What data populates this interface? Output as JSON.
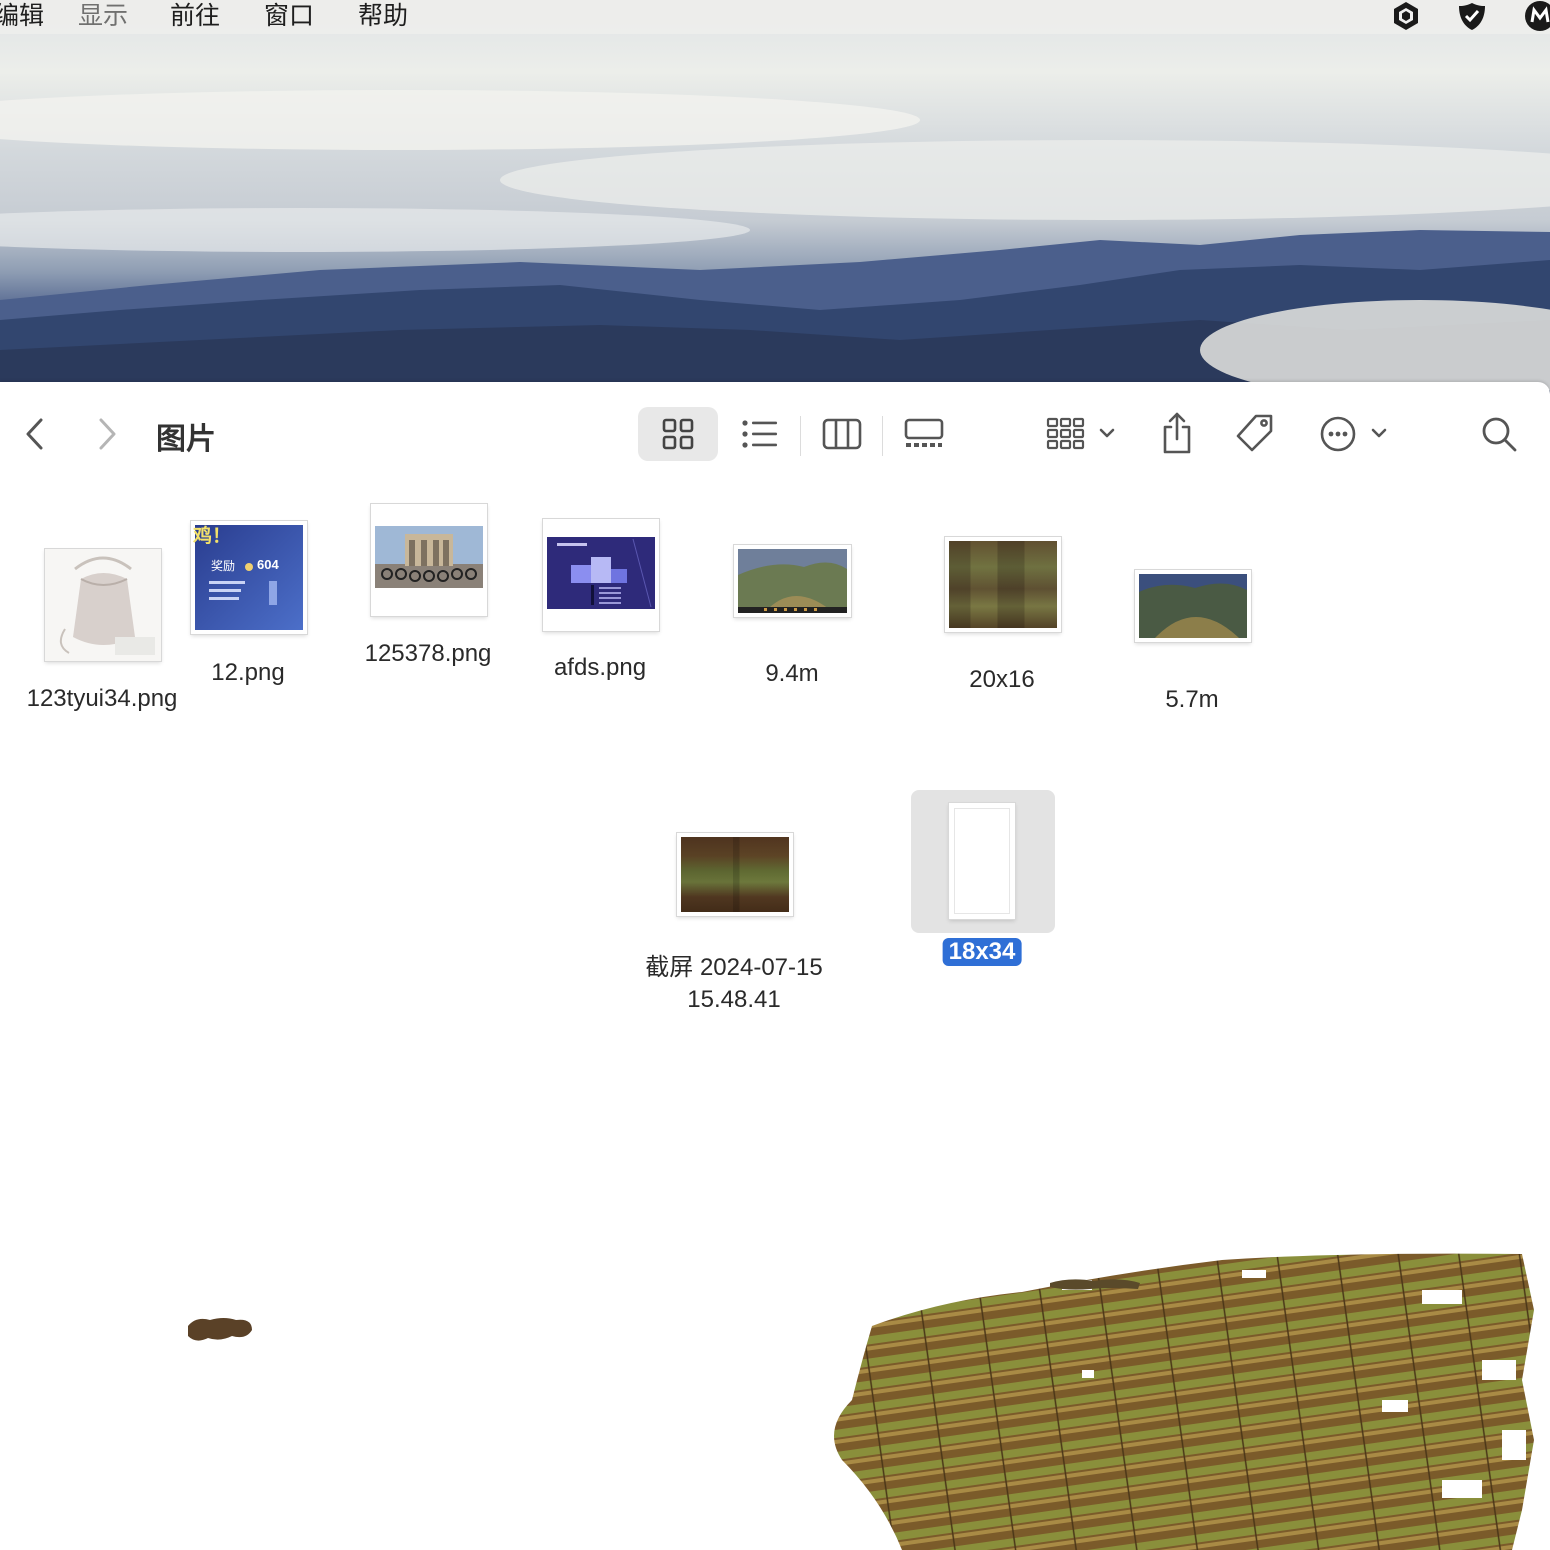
{
  "menubar": {
    "items": [
      "编辑",
      "显示",
      "前往",
      "窗口",
      "帮助"
    ],
    "status_icons": [
      "shield-hexagon-icon",
      "security-shield-icon",
      "m-app-icon"
    ]
  },
  "finder": {
    "title": "图片",
    "toolbar": {
      "back": "chevron-left-icon",
      "forward": "chevron-right-icon",
      "views": [
        "icon-view-icon",
        "list-view-icon",
        "column-view-icon",
        "gallery-view-icon"
      ],
      "active_view": "icon-view-icon",
      "actions": [
        "group-icon",
        "share-icon",
        "tag-icon",
        "more-icon",
        "search-icon"
      ]
    },
    "files": [
      {
        "name": "123tyui34.png"
      },
      {
        "name": "12.png"
      },
      {
        "name": "125378.png"
      },
      {
        "name": "afds.png"
      },
      {
        "name": "9.4m"
      },
      {
        "name": "20x16"
      },
      {
        "name": "5.7m"
      },
      {
        "name": "截屏 2024-07-15 15.48.41"
      },
      {
        "name": "18x34",
        "selected": true
      }
    ],
    "thumb_text": {
      "game_title": "鸡！",
      "reward_label": "奖励",
      "reward_value": "604"
    }
  },
  "colors": {
    "selection": "#2f6fd6",
    "active_view_bg": "#e8e8e8"
  }
}
